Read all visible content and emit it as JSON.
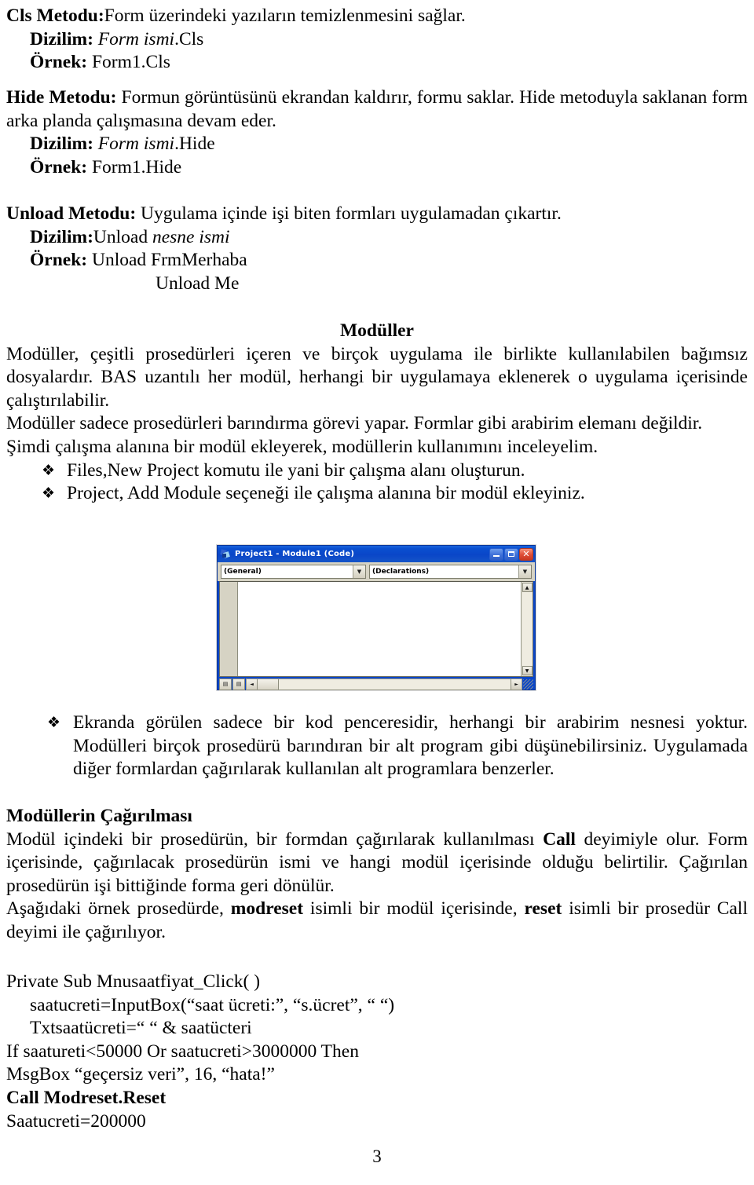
{
  "document": {
    "page_number": "3",
    "sections": {
      "cls": {
        "title_bold": "Cls Metodu:",
        "title_rest": "Form üzerindeki yazıların temizlenmesini sağlar.",
        "dizilim_label": "Dizilim:",
        "dizilim_italic": " Form ismi",
        "dizilim_rest": ".Cls",
        "ornek_label": "Örnek:",
        "ornek_rest": " Form1.Cls"
      },
      "hide": {
        "title_bold": "Hide Metodu:",
        "title_rest": " Formun görüntüsünü ekrandan kaldırır, formu saklar. Hide metoduyla saklanan form arka planda çalışmasına devam eder.",
        "dizilim_label": "Dizilim:",
        "dizilim_italic": " Form ismi",
        "dizilim_rest": ".Hide",
        "ornek_label": "Örnek:",
        "ornek_rest": " Form1.Hide"
      },
      "unload": {
        "title_bold": "Unload Metodu:",
        "title_rest": " Uygulama içinde işi biten formları uygulamadan çıkartır.",
        "dizilim_label": "Dizilim:",
        "dizilim_rest": "Unload ",
        "dizilim_italic": "nesne ismi",
        "ornek_label": "Örnek:",
        "ornek_rest": " Unload FrmMerhaba",
        "ornek_line2": "Unload Me"
      },
      "moduller": {
        "heading": "Modüller",
        "para1": "Modüller, çeşitli prosedürleri içeren ve birçok uygulama ile birlikte kullanılabilen bağımsız dosyalardır. BAS uzantılı her modül, herhangi bir uygulamaya eklenerek o uygulama içerisinde çalıştırılabilir.",
        "para2": "Modüller sadece prosedürleri barındırma görevi yapar. Formlar gibi arabirim elemanı değildir.",
        "para3": "Şimdi çalışma alanına bir modül ekleyerek, modüllerin kullanımını inceleyelim.",
        "bullets": [
          "Files,New Project komutu ile yani bir çalışma alanı oluşturun.",
          "Project, Add Module seçeneği ile çalışma alanına bir modül ekleyiniz."
        ]
      },
      "after_image": {
        "bullet": "Ekranda görülen sadece bir kod penceresidir, herhangi bir arabirim nesnesi yoktur. Modülleri birçok prosedürü barındıran bir alt program gibi düşünebilirsiniz. Uygulamada diğer formlardan çağırılarak kullanılan alt programlara benzerler."
      },
      "cagirilmasi": {
        "heading": "Modüllerin Çağırılması",
        "para1_a": "Modül içindeki bir prosedürün, bir formdan çağırılarak kullanılması ",
        "para1_bold": "Call",
        "para1_b": " deyimiyle olur. Form içerisinde, çağırılacak prosedürün ismi ve hangi modül içerisinde olduğu belirtilir. Çağırılan prosedürün işi bittiğinde forma geri dönülür.",
        "para2_a": "Aşağıdaki örnek prosedürde, ",
        "para2_bold1": "modreset",
        "para2_b": " isimli bir modül içerisinde, ",
        "para2_bold2": "reset",
        "para2_c": " isimli bir prosedür Call deyimi ile çağırılıyor."
      },
      "code_listing": {
        "line1": "Private Sub Mnusaatfiyat_Click( )",
        "line2": "saatucreti=InputBox(“saat ücreti:”, “s.ücret”, “ “)",
        "line3": "Txtsaatücreti=“ “ & saatücteri",
        "line4": "If saatureti<50000 Or saatucreti>3000000 Then",
        "line5": "MsgBox “geçersiz veri”, 16, “hata!”",
        "line6_bold": "Call Modreset.Reset",
        "line7": "Saatucreti=200000"
      }
    }
  },
  "vb_window": {
    "title": "Project1 - Module1 (Code)",
    "icon": "vb-module-icon",
    "minimize_label": "_",
    "restore_label": "❐",
    "close_label": "✕",
    "object_combo": "(General)",
    "procedure_combo": "(Declarations)",
    "combo_arrow": "▼",
    "scroll_up": "▲",
    "scroll_down": "▼",
    "scroll_left": "◄",
    "scroll_right": "►",
    "procedure_view_label": "▤",
    "full_module_view_label": "▤",
    "code_text": "",
    "colors": {
      "titlebar": "#0a46c8",
      "toolbar": "#d6d3c4",
      "close_button": "#e0503a",
      "code_background": "#ffffff"
    }
  },
  "bullet_glyph": "❖"
}
